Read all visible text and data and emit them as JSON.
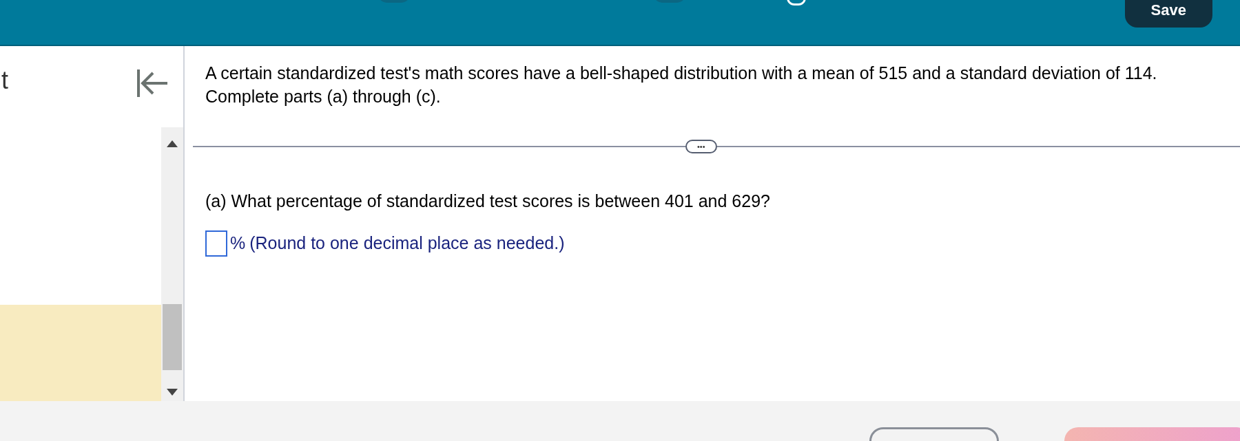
{
  "header": {
    "save_button": "Save"
  },
  "sidebar": {
    "partial_title": "t"
  },
  "question": {
    "intro": "A certain standardized test's math scores have a bell-shaped distribution with a mean of 515 and a standard deviation of 114.",
    "instruction": "Complete parts (a) through (c).",
    "more_button": "•••",
    "part_a": {
      "prompt": "(a) What percentage of standardized test scores is between 401 and 629?",
      "answer": {
        "unit": "%",
        "hint": "(Round to one decimal place as needed.)"
      }
    }
  }
}
